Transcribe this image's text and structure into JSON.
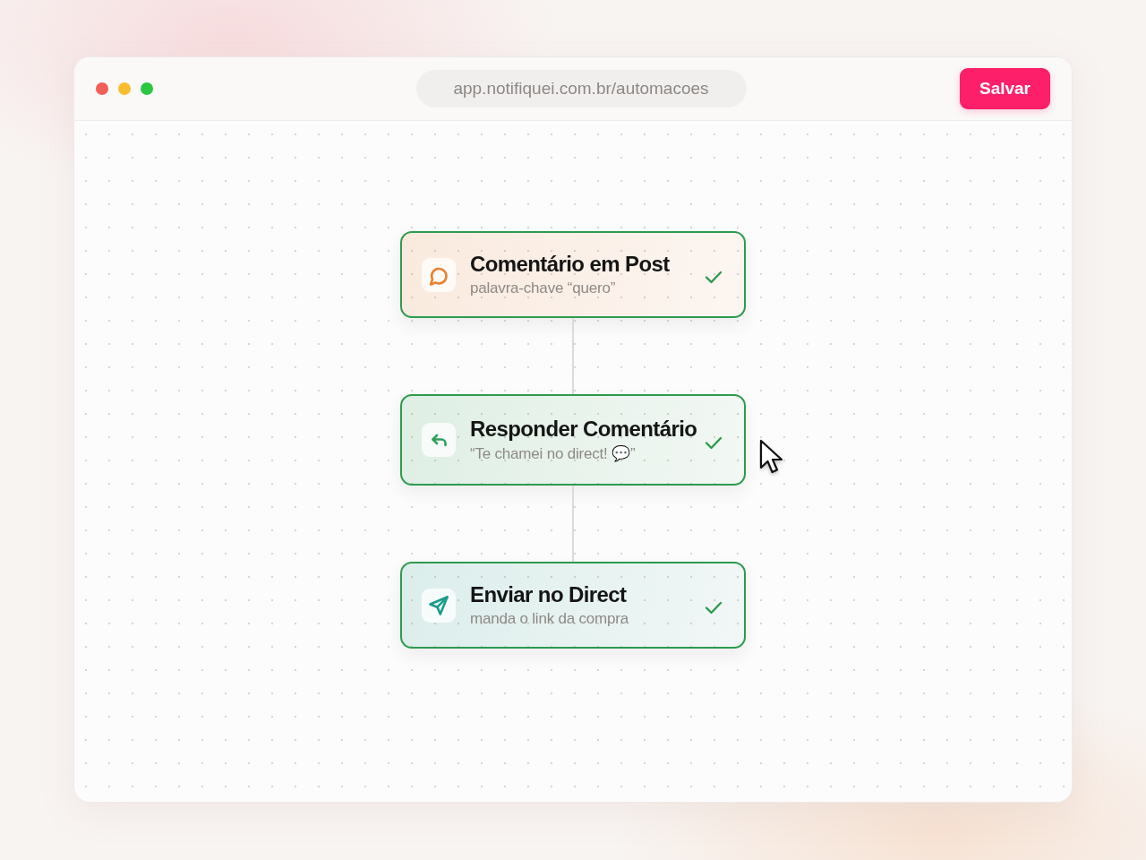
{
  "browser": {
    "url": "app.notifiquei.com.br/automacoes",
    "save_button": "Salvar"
  },
  "flow": {
    "nodes": [
      {
        "kind": "trigger",
        "title": "Comentário em Post",
        "subtitle": "palavra-chave “quero”",
        "completed": true
      },
      {
        "kind": "reply",
        "title": "Responder Comentário",
        "subtitle": "“Te chamei no direct! 💬”",
        "completed": true
      },
      {
        "kind": "send",
        "title": "Enviar no Direct",
        "subtitle": "manda o link da compra",
        "completed": true
      }
    ]
  }
}
